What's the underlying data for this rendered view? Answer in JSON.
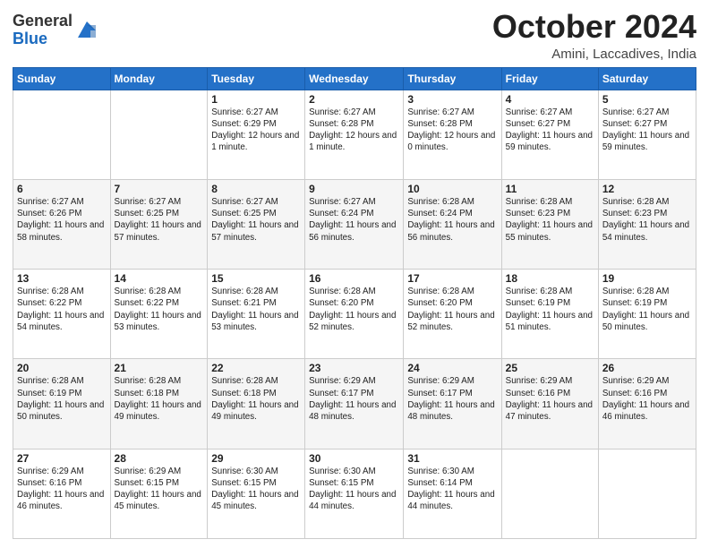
{
  "logo": {
    "line1": "General",
    "line2": "Blue"
  },
  "header": {
    "month": "October 2024",
    "location": "Amini, Laccadives, India"
  },
  "weekdays": [
    "Sunday",
    "Monday",
    "Tuesday",
    "Wednesday",
    "Thursday",
    "Friday",
    "Saturday"
  ],
  "rows": [
    [
      {
        "day": "",
        "sunrise": "",
        "sunset": "",
        "daylight": ""
      },
      {
        "day": "",
        "sunrise": "",
        "sunset": "",
        "daylight": ""
      },
      {
        "day": "1",
        "sunrise": "Sunrise: 6:27 AM",
        "sunset": "Sunset: 6:29 PM",
        "daylight": "Daylight: 12 hours and 1 minute."
      },
      {
        "day": "2",
        "sunrise": "Sunrise: 6:27 AM",
        "sunset": "Sunset: 6:28 PM",
        "daylight": "Daylight: 12 hours and 1 minute."
      },
      {
        "day": "3",
        "sunrise": "Sunrise: 6:27 AM",
        "sunset": "Sunset: 6:28 PM",
        "daylight": "Daylight: 12 hours and 0 minutes."
      },
      {
        "day": "4",
        "sunrise": "Sunrise: 6:27 AM",
        "sunset": "Sunset: 6:27 PM",
        "daylight": "Daylight: 11 hours and 59 minutes."
      },
      {
        "day": "5",
        "sunrise": "Sunrise: 6:27 AM",
        "sunset": "Sunset: 6:27 PM",
        "daylight": "Daylight: 11 hours and 59 minutes."
      }
    ],
    [
      {
        "day": "6",
        "sunrise": "Sunrise: 6:27 AM",
        "sunset": "Sunset: 6:26 PM",
        "daylight": "Daylight: 11 hours and 58 minutes."
      },
      {
        "day": "7",
        "sunrise": "Sunrise: 6:27 AM",
        "sunset": "Sunset: 6:25 PM",
        "daylight": "Daylight: 11 hours and 57 minutes."
      },
      {
        "day": "8",
        "sunrise": "Sunrise: 6:27 AM",
        "sunset": "Sunset: 6:25 PM",
        "daylight": "Daylight: 11 hours and 57 minutes."
      },
      {
        "day": "9",
        "sunrise": "Sunrise: 6:27 AM",
        "sunset": "Sunset: 6:24 PM",
        "daylight": "Daylight: 11 hours and 56 minutes."
      },
      {
        "day": "10",
        "sunrise": "Sunrise: 6:28 AM",
        "sunset": "Sunset: 6:24 PM",
        "daylight": "Daylight: 11 hours and 56 minutes."
      },
      {
        "day": "11",
        "sunrise": "Sunrise: 6:28 AM",
        "sunset": "Sunset: 6:23 PM",
        "daylight": "Daylight: 11 hours and 55 minutes."
      },
      {
        "day": "12",
        "sunrise": "Sunrise: 6:28 AM",
        "sunset": "Sunset: 6:23 PM",
        "daylight": "Daylight: 11 hours and 54 minutes."
      }
    ],
    [
      {
        "day": "13",
        "sunrise": "Sunrise: 6:28 AM",
        "sunset": "Sunset: 6:22 PM",
        "daylight": "Daylight: 11 hours and 54 minutes."
      },
      {
        "day": "14",
        "sunrise": "Sunrise: 6:28 AM",
        "sunset": "Sunset: 6:22 PM",
        "daylight": "Daylight: 11 hours and 53 minutes."
      },
      {
        "day": "15",
        "sunrise": "Sunrise: 6:28 AM",
        "sunset": "Sunset: 6:21 PM",
        "daylight": "Daylight: 11 hours and 53 minutes."
      },
      {
        "day": "16",
        "sunrise": "Sunrise: 6:28 AM",
        "sunset": "Sunset: 6:20 PM",
        "daylight": "Daylight: 11 hours and 52 minutes."
      },
      {
        "day": "17",
        "sunrise": "Sunrise: 6:28 AM",
        "sunset": "Sunset: 6:20 PM",
        "daylight": "Daylight: 11 hours and 52 minutes."
      },
      {
        "day": "18",
        "sunrise": "Sunrise: 6:28 AM",
        "sunset": "Sunset: 6:19 PM",
        "daylight": "Daylight: 11 hours and 51 minutes."
      },
      {
        "day": "19",
        "sunrise": "Sunrise: 6:28 AM",
        "sunset": "Sunset: 6:19 PM",
        "daylight": "Daylight: 11 hours and 50 minutes."
      }
    ],
    [
      {
        "day": "20",
        "sunrise": "Sunrise: 6:28 AM",
        "sunset": "Sunset: 6:19 PM",
        "daylight": "Daylight: 11 hours and 50 minutes."
      },
      {
        "day": "21",
        "sunrise": "Sunrise: 6:28 AM",
        "sunset": "Sunset: 6:18 PM",
        "daylight": "Daylight: 11 hours and 49 minutes."
      },
      {
        "day": "22",
        "sunrise": "Sunrise: 6:28 AM",
        "sunset": "Sunset: 6:18 PM",
        "daylight": "Daylight: 11 hours and 49 minutes."
      },
      {
        "day": "23",
        "sunrise": "Sunrise: 6:29 AM",
        "sunset": "Sunset: 6:17 PM",
        "daylight": "Daylight: 11 hours and 48 minutes."
      },
      {
        "day": "24",
        "sunrise": "Sunrise: 6:29 AM",
        "sunset": "Sunset: 6:17 PM",
        "daylight": "Daylight: 11 hours and 48 minutes."
      },
      {
        "day": "25",
        "sunrise": "Sunrise: 6:29 AM",
        "sunset": "Sunset: 6:16 PM",
        "daylight": "Daylight: 11 hours and 47 minutes."
      },
      {
        "day": "26",
        "sunrise": "Sunrise: 6:29 AM",
        "sunset": "Sunset: 6:16 PM",
        "daylight": "Daylight: 11 hours and 46 minutes."
      }
    ],
    [
      {
        "day": "27",
        "sunrise": "Sunrise: 6:29 AM",
        "sunset": "Sunset: 6:16 PM",
        "daylight": "Daylight: 11 hours and 46 minutes."
      },
      {
        "day": "28",
        "sunrise": "Sunrise: 6:29 AM",
        "sunset": "Sunset: 6:15 PM",
        "daylight": "Daylight: 11 hours and 45 minutes."
      },
      {
        "day": "29",
        "sunrise": "Sunrise: 6:30 AM",
        "sunset": "Sunset: 6:15 PM",
        "daylight": "Daylight: 11 hours and 45 minutes."
      },
      {
        "day": "30",
        "sunrise": "Sunrise: 6:30 AM",
        "sunset": "Sunset: 6:15 PM",
        "daylight": "Daylight: 11 hours and 44 minutes."
      },
      {
        "day": "31",
        "sunrise": "Sunrise: 6:30 AM",
        "sunset": "Sunset: 6:14 PM",
        "daylight": "Daylight: 11 hours and 44 minutes."
      },
      {
        "day": "",
        "sunrise": "",
        "sunset": "",
        "daylight": ""
      },
      {
        "day": "",
        "sunrise": "",
        "sunset": "",
        "daylight": ""
      }
    ]
  ]
}
